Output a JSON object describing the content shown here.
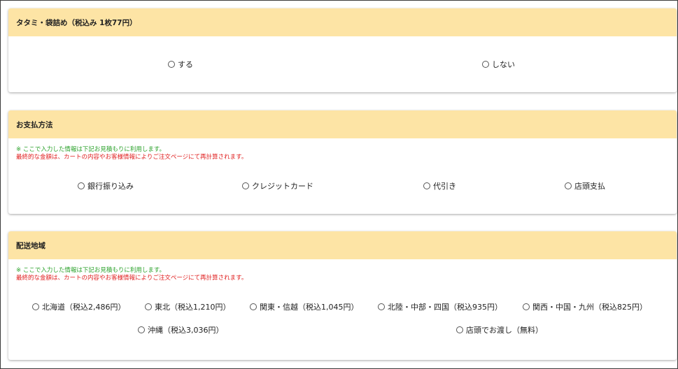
{
  "tatami": {
    "title": "タタミ・袋詰め（税込み 1枚77円）",
    "options": [
      {
        "label": "する"
      },
      {
        "label": "しない"
      }
    ]
  },
  "payment": {
    "title": "お支払方法",
    "note_green": "※ ここで入力した情報は下記お見積もりに利用します。",
    "note_red": "最終的な金額は、カートの内容やお客様情報によりご注文ページにて再計算されます。",
    "options": [
      {
        "label": "銀行振り込み"
      },
      {
        "label": "クレジットカード"
      },
      {
        "label": "代引き"
      },
      {
        "label": "店頭支払"
      }
    ]
  },
  "delivery": {
    "title": "配送地域",
    "note_green": "※ ここで入力した情報は下記お見積もりに利用します。",
    "note_red": "最終的な金額は、カートの内容やお客様情報によりご注文ページにて再計算されます。",
    "options": [
      {
        "label": "北海道（税込2,486円）"
      },
      {
        "label": "東北（税込1,210円）"
      },
      {
        "label": "関東・信越（税込1,045円）"
      },
      {
        "label": "北陸・中部・四国（税込935円）"
      },
      {
        "label": "関西・中国・九州（税込825円）"
      },
      {
        "label": "沖縄（税込3,036円）"
      },
      {
        "label": "店頭でお渡し（無料）"
      }
    ]
  },
  "colors": {
    "header_bg": "#fde4a5",
    "note_green": "#2aa12a",
    "note_red": "#e02020"
  }
}
